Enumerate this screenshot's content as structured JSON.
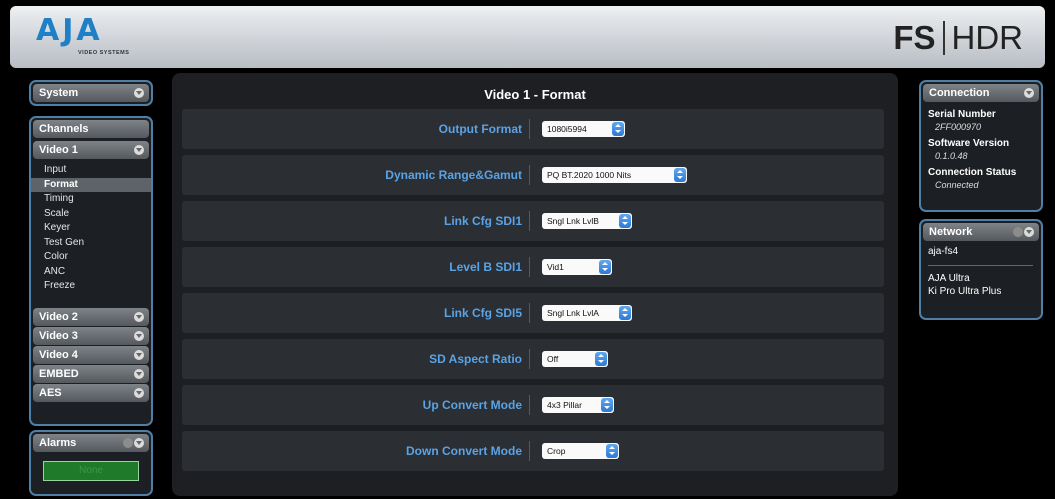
{
  "header": {
    "logo_text": "AJA",
    "logo_subtitle": "VIDEO SYSTEMS",
    "product_bold": "FS",
    "product_light": "HDR"
  },
  "sidebar": {
    "system_label": "System",
    "channels_label": "Channels",
    "video1_label": "Video 1",
    "video1_items": [
      "Input",
      "Format",
      "Timing",
      "Scale",
      "Keyer",
      "Test Gen",
      "Color",
      "ANC",
      "Freeze"
    ],
    "selected_item": "Format",
    "other_channels": [
      "Video 2",
      "Video 3",
      "Video 4",
      "EMBED",
      "AES"
    ],
    "alarms_label": "Alarms",
    "alarm_status": "None"
  },
  "main": {
    "title": "Video 1 - Format",
    "rows": [
      {
        "label": "Output Format",
        "value": "1080i5994"
      },
      {
        "label": "Dynamic Range&Gamut",
        "value": "PQ BT.2020 1000 Nits"
      },
      {
        "label": "Link Cfg SDI1",
        "value": "Sngl Lnk LvlB"
      },
      {
        "label": "Level B SDI1",
        "value": "Vid1"
      },
      {
        "label": "Link Cfg SDI5",
        "value": "Sngl Lnk LvlA"
      },
      {
        "label": "SD Aspect Ratio",
        "value": "Off"
      },
      {
        "label": "Up Convert Mode",
        "value": "4x3 Pillar"
      },
      {
        "label": "Down Convert Mode",
        "value": "Crop"
      }
    ]
  },
  "connection": {
    "title": "Connection",
    "serial_label": "Serial Number",
    "serial_value": "2FF000970",
    "software_label": "Software Version",
    "software_value": "0.1.0.48",
    "status_label": "Connection Status",
    "status_value": "Connected"
  },
  "network": {
    "title": "Network",
    "host": "aja-fs4",
    "devices": [
      "AJA Ultra",
      "Ki Pro Ultra Plus"
    ]
  },
  "colors": {
    "accent_blue": "#5aa3e6",
    "panel_border": "#4f7fa5",
    "alarm_green": "#1f7a2a"
  }
}
